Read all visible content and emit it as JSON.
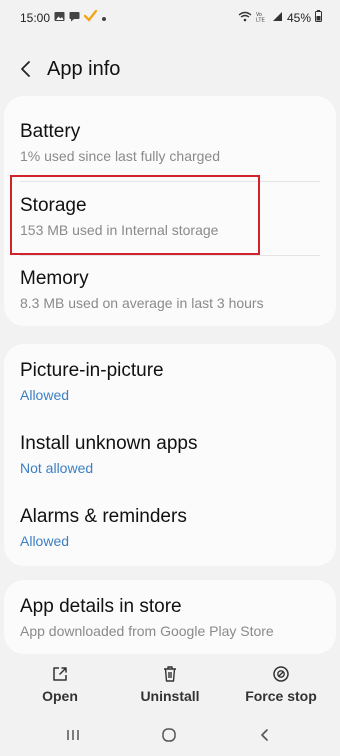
{
  "status_bar": {
    "time": "15:00",
    "battery": "45%",
    "icons_left": [
      "gallery-icon",
      "message-icon",
      "checkmark-icon",
      "dot-icon"
    ],
    "icons_right": [
      "wifi-icon",
      "volte-icon",
      "signal-icon",
      "battery-icon"
    ]
  },
  "header": {
    "title": "App info"
  },
  "card1": {
    "items": [
      {
        "title": "Battery",
        "subtitle": "1% used since last fully charged"
      },
      {
        "title": "Storage",
        "subtitle": "153 MB used in Internal storage"
      },
      {
        "title": "Memory",
        "subtitle": "8.3 MB used on average in last 3 hours"
      }
    ]
  },
  "card2": {
    "items": [
      {
        "title": "Picture-in-picture",
        "subtitle": "Allowed"
      },
      {
        "title": "Install unknown apps",
        "subtitle": "Not allowed"
      },
      {
        "title": "Alarms & reminders",
        "subtitle": "Allowed"
      }
    ]
  },
  "card3": {
    "items": [
      {
        "title": "App details in store",
        "subtitle": "App downloaded from Google Play Store"
      }
    ]
  },
  "actions": {
    "open": "Open",
    "uninstall": "Uninstall",
    "force_stop": "Force stop"
  },
  "colors": {
    "accent": "#3b7fc4",
    "highlight": "#d0232a"
  }
}
